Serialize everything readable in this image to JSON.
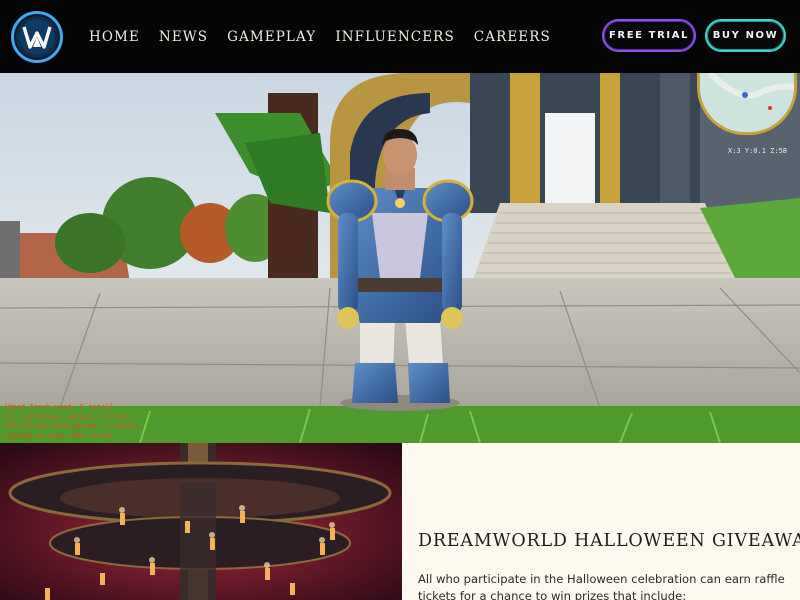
{
  "brand": {
    "logo_letter": "W",
    "logo_icon": "dreamworld-logo-icon"
  },
  "nav": {
    "links": [
      "HOME",
      "NEWS",
      "GAMEPLAY",
      "INFLUENCERS",
      "CAREERS"
    ],
    "free_trial": "FREE TRIAL",
    "buy_now": "BUY NOW"
  },
  "colors": {
    "nav_bg": "#040404",
    "trial_accent": "#8a4fe0",
    "buy_accent": "#37d6c8",
    "news_bg": "#fdf9ef"
  },
  "hero": {
    "chat_lines": [
      "[Weed Torch used: 5 total]",
      "[*] outfitness gained, 3 total",
      "[Petrified Gold gained, 4 total]",
      "[Sandwich used: 805 total]"
    ],
    "coords": "X:3 Y:0.1 Z:58"
  },
  "news": {
    "title": "DREAMWORLD HALLOWEEN GIVEAWAY",
    "body": "All who participate in the Halloween celebration can earn raffle tickets for a chance to win prizes that include:"
  }
}
